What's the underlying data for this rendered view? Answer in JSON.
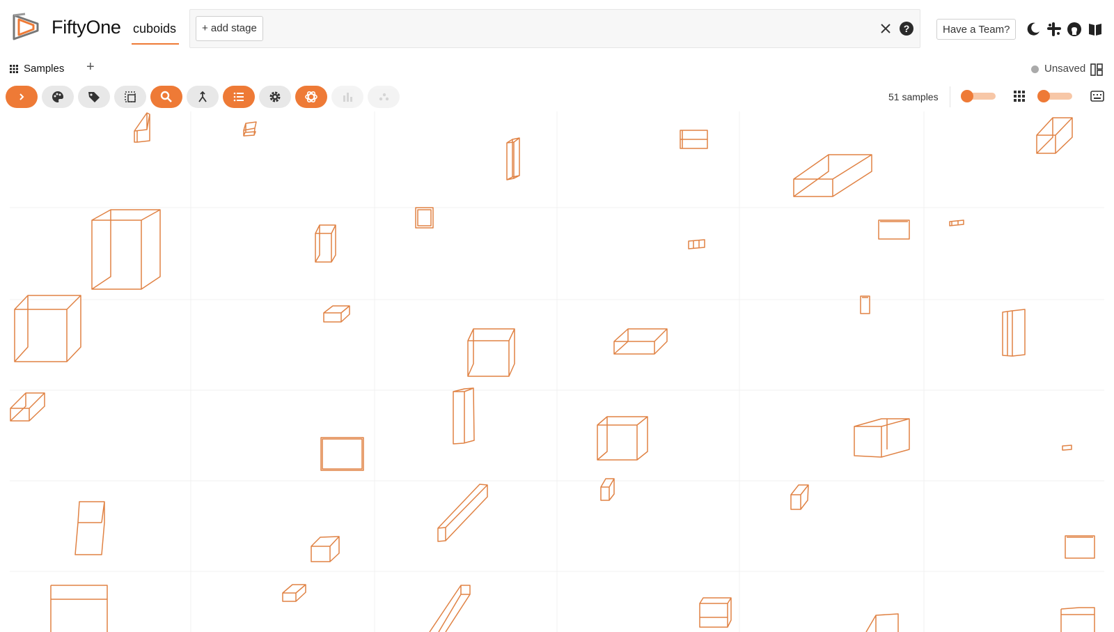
{
  "app": {
    "brand": "FiftyOne",
    "dataset": "cuboids",
    "brand_color": "#ee7a36"
  },
  "search": {
    "add_stage_label": "+ add stage"
  },
  "header": {
    "team_button": "Have a Team?"
  },
  "tabs": [
    {
      "label": "Samples"
    }
  ],
  "view": {
    "status_label": "Unsaved",
    "sample_count_label": "51 samples"
  },
  "toolbar": {
    "buttons": [
      {
        "name": "sidebar-toggle",
        "icon": "chevron-right-icon",
        "active": true
      },
      {
        "name": "color-scheme",
        "icon": "palette-icon",
        "active": false
      },
      {
        "name": "tag",
        "icon": "tag-icon",
        "active": false
      },
      {
        "name": "select-patches",
        "icon": "patches-icon",
        "active": false
      },
      {
        "name": "similarity-search",
        "icon": "search-icon",
        "active": true
      },
      {
        "name": "merge",
        "icon": "merge-icon",
        "active": false
      },
      {
        "name": "operators",
        "icon": "list-icon",
        "active": true
      },
      {
        "name": "settings",
        "icon": "gear-icon",
        "active": false
      },
      {
        "name": "openai",
        "icon": "openai-icon",
        "active": true
      },
      {
        "name": "histograms",
        "icon": "bar-chart-icon",
        "active": false
      },
      {
        "name": "embeddings",
        "icon": "scatter-icon",
        "active": false
      }
    ]
  },
  "grid": {
    "columns": 6,
    "rows": 6,
    "label_color": "#e08244"
  }
}
